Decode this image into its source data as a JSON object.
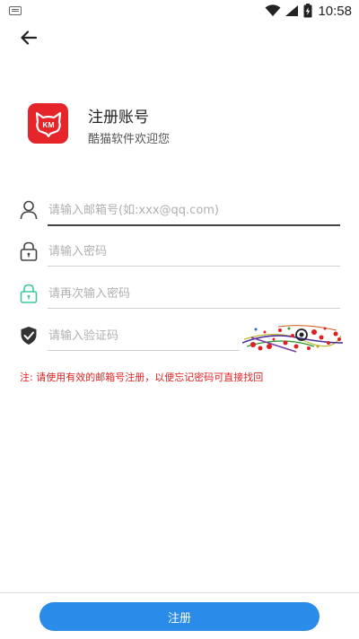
{
  "status_bar": {
    "time": "10:58",
    "icons": [
      "keyboard-icon",
      "wifi-icon",
      "signal-icon",
      "battery-charging-icon"
    ]
  },
  "header": {
    "back_icon": "arrow-left-icon",
    "title": "注册账号",
    "subtitle": "酷猫软件欢迎您",
    "logo_text": "KM"
  },
  "form": {
    "email": {
      "placeholder": "请输入邮箱号(如:xxx@qq.com)",
      "value": "",
      "icon": "user-icon"
    },
    "password": {
      "placeholder": "请输入密码",
      "value": "",
      "icon": "lock-icon"
    },
    "password_confirm": {
      "placeholder": "请再次输入密码",
      "value": "",
      "icon": "lock-icon"
    },
    "captcha": {
      "placeholder": "请输入验证码",
      "value": "",
      "icon": "shield-check-icon"
    }
  },
  "notice": "注: 请使用有效的邮箱号注册，以便忘记密码可直接找回",
  "register_button": "注册",
  "colors": {
    "brand_red": "#e5252a",
    "accent_blue": "#2b8be8",
    "notice_red": "#e02222",
    "confirm_lock_green": "#3cc8a0"
  }
}
